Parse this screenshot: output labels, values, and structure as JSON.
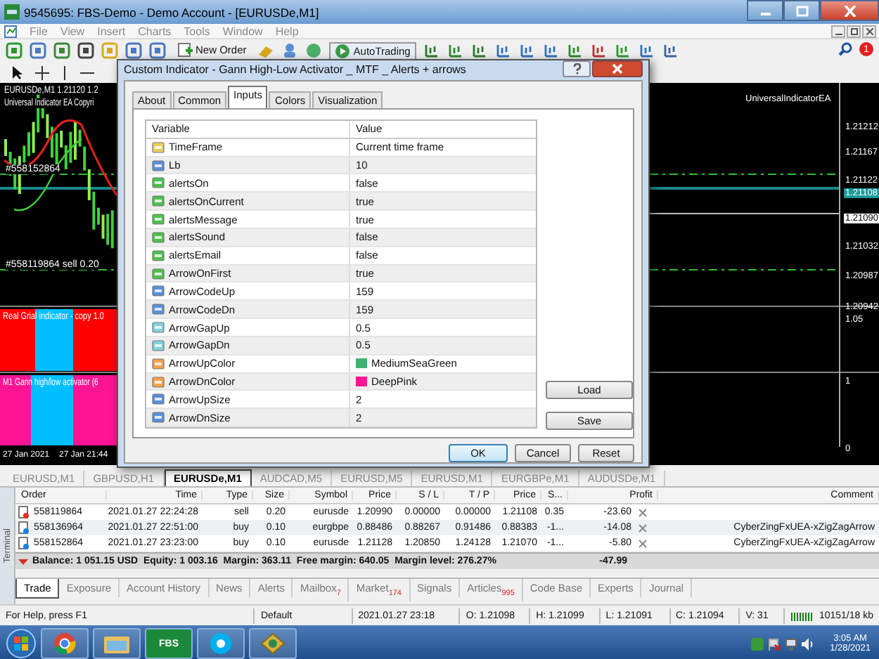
{
  "window": {
    "title": "9545695: FBS-Demo - Demo Account - [EURUSDe,M1]"
  },
  "menu": [
    "File",
    "View",
    "Insert",
    "Charts",
    "Tools",
    "Window",
    "Help"
  ],
  "toolbar": {
    "new_order": "New Order",
    "auto_trading": "AutoTrading",
    "notifications": "1"
  },
  "chart": {
    "symbol_line": "EURUSDe,M1 1.21120 1.2",
    "ea_line": "Universal Indicator EA Copyri",
    "ea_label": "UniversalIndicatorEA",
    "order_labels": [
      "#558152864",
      "#558119864 sell 0.20"
    ],
    "subwindows": [
      "Real Grial indicator - copy 1.0",
      "M1 Gann high/low activator (6"
    ],
    "time_labels": [
      "27 Jan 2021",
      "27 Jan 21:44"
    ],
    "price_labels": [
      {
        "text": "1.21212",
        "kind": "tick"
      },
      {
        "text": "1.21167",
        "kind": "tick"
      },
      {
        "text": "1.21122",
        "kind": "tick"
      },
      {
        "text": "1.21108",
        "kind": "bid"
      },
      {
        "text": "1.21090",
        "kind": "ask"
      },
      {
        "text": "1.21032",
        "kind": "tick"
      },
      {
        "text": "1.20987",
        "kind": "tick"
      },
      {
        "text": "1.20942",
        "kind": "tick"
      },
      {
        "text": "1.05",
        "kind": "tick"
      },
      {
        "text": "1",
        "kind": "tick"
      },
      {
        "text": "0",
        "kind": "tick"
      }
    ]
  },
  "dialog": {
    "title": "Custom Indicator - Gann High-Low Activator _ MTF _ Alerts + arrows",
    "tabs": [
      {
        "label": "About",
        "selected": false
      },
      {
        "label": "Common",
        "selected": false
      },
      {
        "label": "Inputs",
        "selected": true
      },
      {
        "label": "Colors",
        "selected": false
      },
      {
        "label": "Visualization",
        "selected": false
      }
    ],
    "columns": [
      "Variable",
      "Value"
    ],
    "rows": [
      {
        "kind": "string",
        "name": "TimeFrame",
        "value": "Current time frame"
      },
      {
        "kind": "int",
        "name": "Lb",
        "value": "10"
      },
      {
        "kind": "bool",
        "name": "alertsOn",
        "value": "false"
      },
      {
        "kind": "bool",
        "name": "alertsOnCurrent",
        "value": "true"
      },
      {
        "kind": "bool",
        "name": "alertsMessage",
        "value": "true"
      },
      {
        "kind": "bool",
        "name": "alertsSound",
        "value": "false"
      },
      {
        "kind": "bool",
        "name": "alertsEmail",
        "value": "false"
      },
      {
        "kind": "bool",
        "name": "ArrowOnFirst",
        "value": "true"
      },
      {
        "kind": "int",
        "name": "ArrowCodeUp",
        "value": "159"
      },
      {
        "kind": "int",
        "name": "ArrowCodeDn",
        "value": "159"
      },
      {
        "kind": "double",
        "name": "ArrowGapUp",
        "value": "0.5"
      },
      {
        "kind": "double",
        "name": "ArrowGapDn",
        "value": "0.5"
      },
      {
        "kind": "color",
        "name": "ArrowUpColor",
        "value": "MediumSeaGreen",
        "color": "#3cb371"
      },
      {
        "kind": "color",
        "name": "ArrowDnColor",
        "value": "DeepPink",
        "color": "#ff1493"
      },
      {
        "kind": "int",
        "name": "ArrowUpSize",
        "value": "2"
      },
      {
        "kind": "int",
        "name": "ArrowDnSize",
        "value": "2"
      }
    ],
    "side_buttons": [
      "Load",
      "Save"
    ],
    "buttons": [
      "OK",
      "Cancel",
      "Reset"
    ]
  },
  "chart_tabs": [
    {
      "label": "EURUSD,M1",
      "selected": false
    },
    {
      "label": "GBPUSD,H1",
      "selected": false
    },
    {
      "label": "EURUSDe,M1",
      "selected": true
    },
    {
      "label": "AUDCAD,M5",
      "selected": false
    },
    {
      "label": "EURUSD,M5",
      "selected": false
    },
    {
      "label": "EURUSD,M1",
      "selected": false
    },
    {
      "label": "EURGBPe,M1",
      "selected": false
    },
    {
      "label": "AUDUSDe,M1",
      "selected": false
    }
  ],
  "terminal": {
    "label": "Terminal",
    "columns": [
      "Order",
      "Time",
      "Type",
      "Size",
      "Symbol",
      "Price",
      "S / L",
      "T / P",
      "Price",
      "S...",
      "Profit",
      "Comment"
    ],
    "rows": [
      {
        "kind": "sell",
        "cells": [
          "558119864",
          "2021.01.27 22:24:28",
          "sell",
          "0.20",
          "eurusde",
          "1.20990",
          "0.00000",
          "0.00000",
          "1.21108",
          "0.35",
          "-23.60"
        ]
      },
      {
        "kind": "buy",
        "cells": [
          "558136964",
          "2021.01.27 22:51:00",
          "buy",
          "0.10",
          "eurgbpe",
          "0.88486",
          "0.88267",
          "0.91486",
          "0.88383",
          "-1...",
          "-14.08"
        ],
        "comment": "CyberZingFxUEA-xZigZagArrow"
      },
      {
        "kind": "buy",
        "cells": [
          "558152864",
          "2021.01.27 23:23:00",
          "buy",
          "0.10",
          "eurusde",
          "1.21128",
          "1.20850",
          "1.24128",
          "1.21070",
          "-1...",
          "-5.80"
        ],
        "comment": "CyberZingFxUEA-xZigZagArrow"
      }
    ],
    "balance": "Balance: 1 051.15 USD  Equity: 1 003.16  Margin: 363.11  Free margin: 640.05  Margin level: 276.27%",
    "total": "-47.99",
    "tabs": [
      {
        "label": "Trade",
        "selected": true
      },
      {
        "label": "Exposure",
        "selected": false
      },
      {
        "label": "Account History",
        "selected": false
      },
      {
        "label": "News",
        "selected": false
      },
      {
        "label": "Alerts",
        "selected": false
      },
      {
        "label": "Mailbox",
        "badge": "7",
        "selected": false
      },
      {
        "label": "Market",
        "badge": "174",
        "selected": false
      },
      {
        "label": "Signals",
        "selected": false
      },
      {
        "label": "Articles",
        "badge": "995",
        "selected": false
      },
      {
        "label": "Code Base",
        "selected": false
      },
      {
        "label": "Experts",
        "selected": false
      },
      {
        "label": "Journal",
        "selected": false
      }
    ]
  },
  "status_bar": [
    "For Help, press F1",
    "Default",
    "2021.01.27 23:18",
    "O: 1.21098",
    "H: 1.21099",
    "L: 1.21091",
    "C: 1.21094",
    "V: 31",
    "10151/18 kb"
  ],
  "taskbar": {
    "apps": [
      {
        "kind": "browser"
      },
      {
        "kind": "folder"
      },
      {
        "kind": "fbs",
        "label": "FBS"
      },
      {
        "kind": "chat"
      },
      {
        "kind": "terminal"
      }
    ],
    "time": "3:05 AM",
    "date": "1/28/2021"
  }
}
